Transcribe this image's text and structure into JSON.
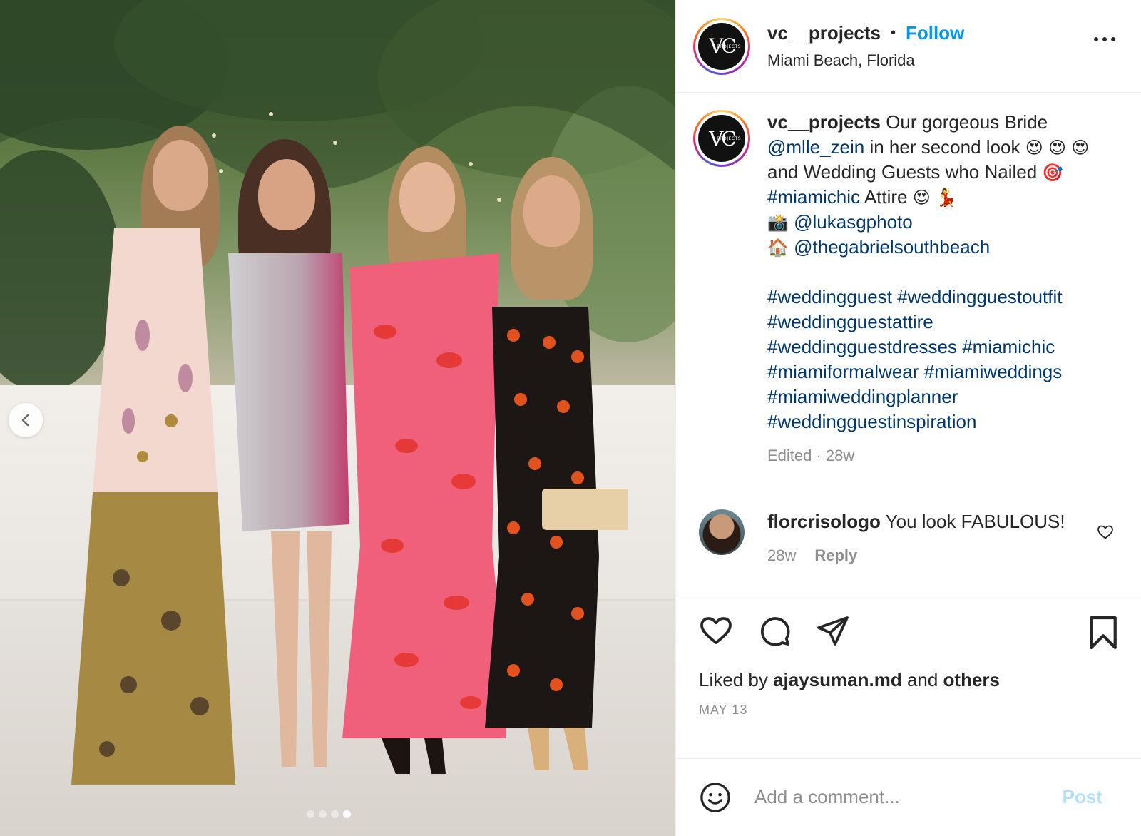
{
  "header": {
    "username": "vc__projects",
    "bullet": "•",
    "follow_label": "Follow",
    "location": "Miami Beach, Florida",
    "avatar_logo": "VC",
    "avatar_logo_sub": "PROJECTS"
  },
  "caption": {
    "username": "vc__projects",
    "text_1": " Our gorgeous Bride ",
    "mention_bride": "@mlle_zein",
    "text_2": " in her second look ",
    "text_3": " and Wedding Guests who Nailed ",
    "hashtag_inline": "#miamichic",
    "text_4": " Attire ",
    "mention_photo": "@lukasgphoto",
    "mention_venue": "@thegabrielsouthbeach",
    "hashtags": [
      "#weddingguest",
      "#weddingguestoutfit",
      "#weddingguestattire",
      "#weddingguestdresses",
      "#miamichic",
      "#miamiformalwear",
      "#miamiweddings",
      "#miamiweddingplanner",
      "#weddingguestinspiration"
    ],
    "emojis": {
      "heart_eyes": "😍",
      "dart": "🎯",
      "dancer": "💃",
      "camera_flash": "📸",
      "house": "🏠"
    },
    "meta": "Edited · 28w"
  },
  "comment": {
    "username": "florcrisologo",
    "text": " You look FABULOUS!",
    "time": "28w",
    "reply_label": "Reply"
  },
  "actions": {
    "icons": [
      "heart-icon",
      "comment-icon",
      "share-icon",
      "bookmark-icon"
    ],
    "liked_by_prefix": "Liked by ",
    "liked_by_user": "ajaysuman.md",
    "liked_by_mid": " and ",
    "liked_by_others": "others",
    "date": "MAY 13"
  },
  "add_comment": {
    "placeholder": "Add a comment...",
    "post_label": "Post"
  },
  "carousel": {
    "total": 4,
    "active": 4
  },
  "colors": {
    "follow_blue": "#0095f6",
    "link_blue": "#00376b",
    "muted_gray": "#8e8e8e",
    "post_disabled": "#b2dffc",
    "text": "#262626"
  }
}
